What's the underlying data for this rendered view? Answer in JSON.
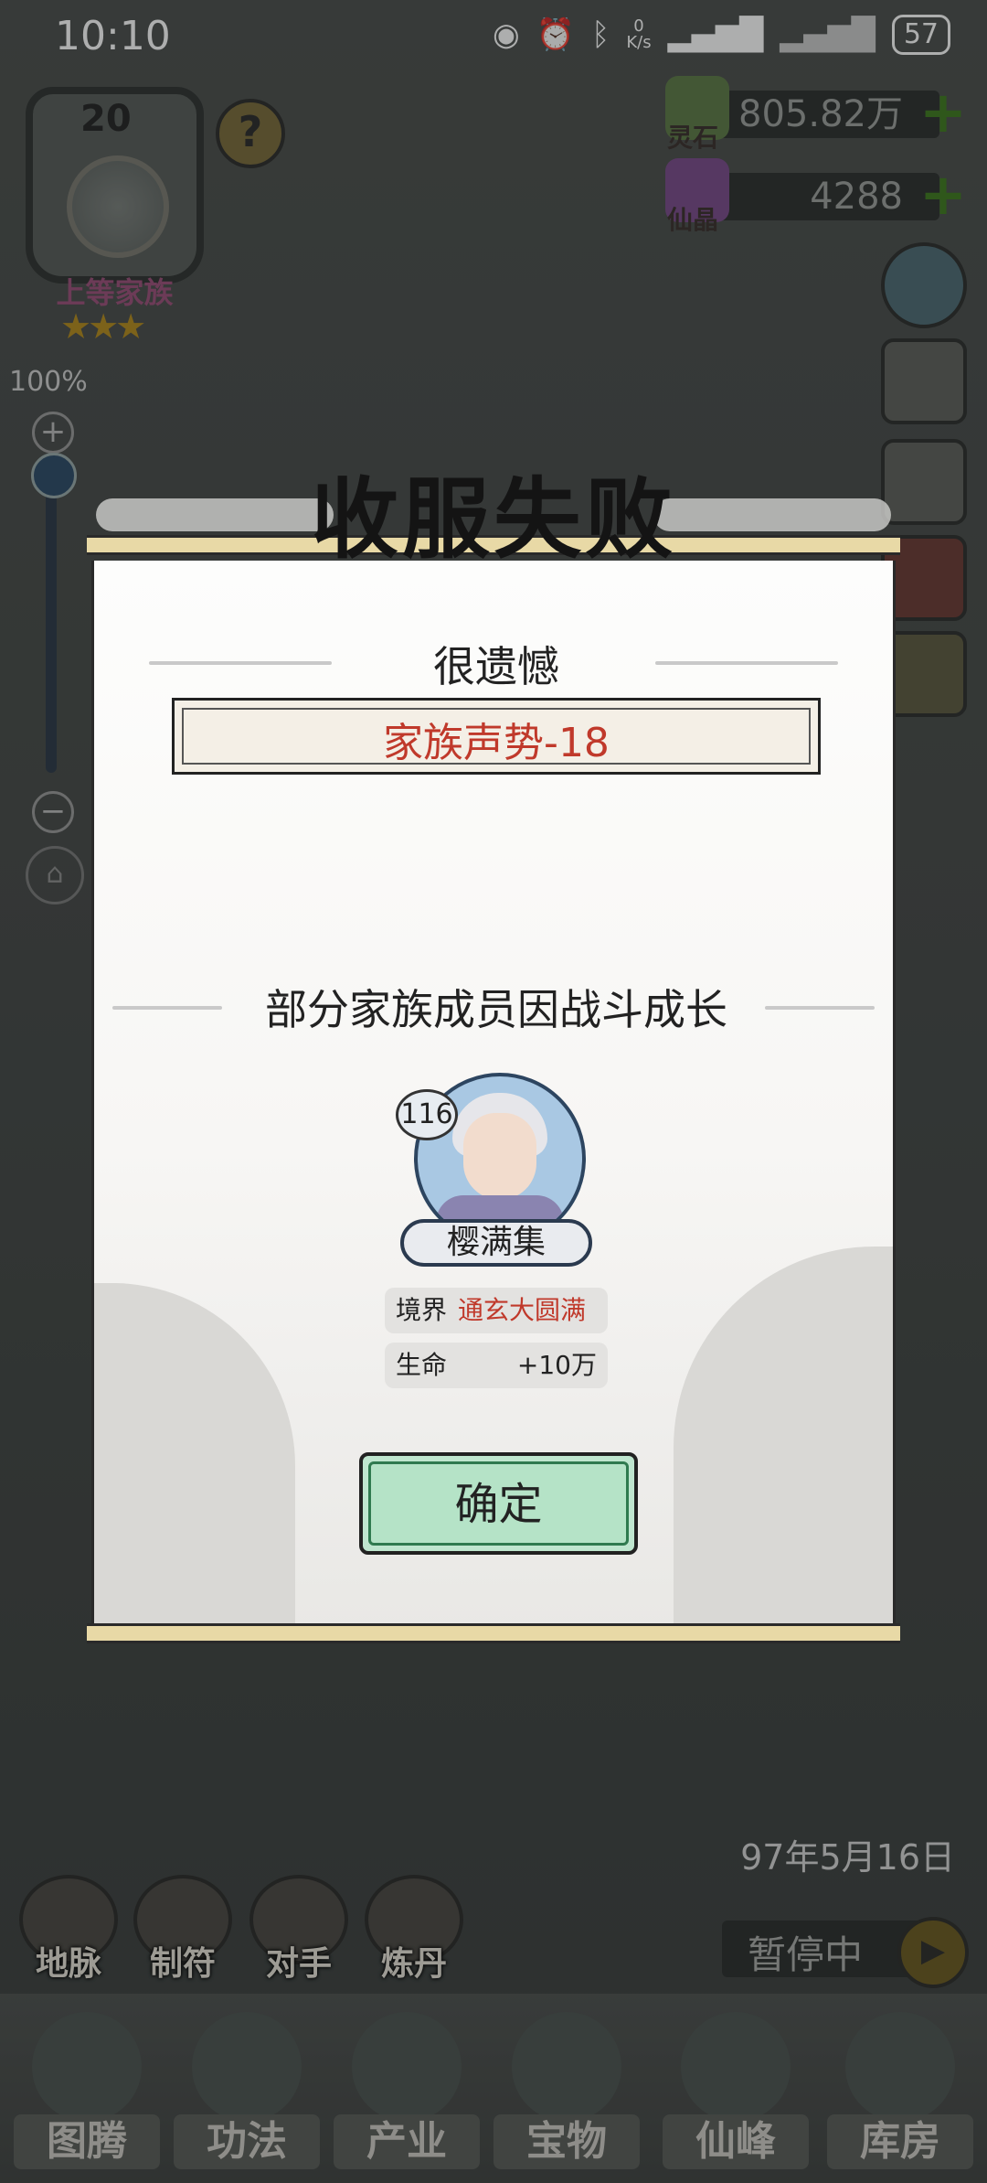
{
  "status_bar": {
    "time": "10:10",
    "net_speed_value": "0",
    "net_speed_unit": "K/s",
    "battery": "57",
    "icons": [
      "eye-icon",
      "alarm-icon",
      "bluetooth-icon",
      "signal-icon",
      "signal-icon"
    ]
  },
  "family": {
    "level": "20",
    "rank": "上等家族",
    "stars": "★★★",
    "help": "?"
  },
  "currencies": [
    {
      "label": "灵石",
      "value": "805.82万",
      "icon": "spirit-stone-icon",
      "color": "#5d7a46"
    },
    {
      "label": "仙晶",
      "value": "4288",
      "icon": "immortal-crystal-icon",
      "color": "#7a4a8a"
    }
  ],
  "zoom": {
    "percent": "100%",
    "plus": "+",
    "minus": "−",
    "level": 1.0
  },
  "game": {
    "date": "97年5月16日",
    "pause_label": "暂停中"
  },
  "function_buttons": [
    {
      "label": "地脉",
      "icon": "earth-vein-icon"
    },
    {
      "label": "制符",
      "icon": "talisman-icon"
    },
    {
      "label": "对手",
      "icon": "opponent-icon"
    },
    {
      "label": "炼丹",
      "icon": "alchemy-cauldron-icon"
    }
  ],
  "bottom_nav": [
    {
      "label": "图腾",
      "icon": "totem-icon"
    },
    {
      "label": "功法",
      "icon": "technique-icon"
    },
    {
      "label": "产业",
      "icon": "industry-icon"
    },
    {
      "label": "宝物",
      "icon": "treasure-icon"
    },
    {
      "label": "仙峰",
      "icon": "immortal-peak-icon"
    },
    {
      "label": "库房",
      "icon": "storehouse-icon"
    }
  ],
  "modal": {
    "title": "收服失败",
    "subtitle": "很遗憾",
    "prestige_change": "家族声势-18",
    "growth_title": "部分家族成员因战斗成长",
    "member": {
      "level": "116",
      "name": "樱满集",
      "realm_label": "境界",
      "realm_value": "通玄大圆满",
      "life_label": "生命",
      "life_value": "+10万"
    },
    "confirm_label": "确定"
  }
}
